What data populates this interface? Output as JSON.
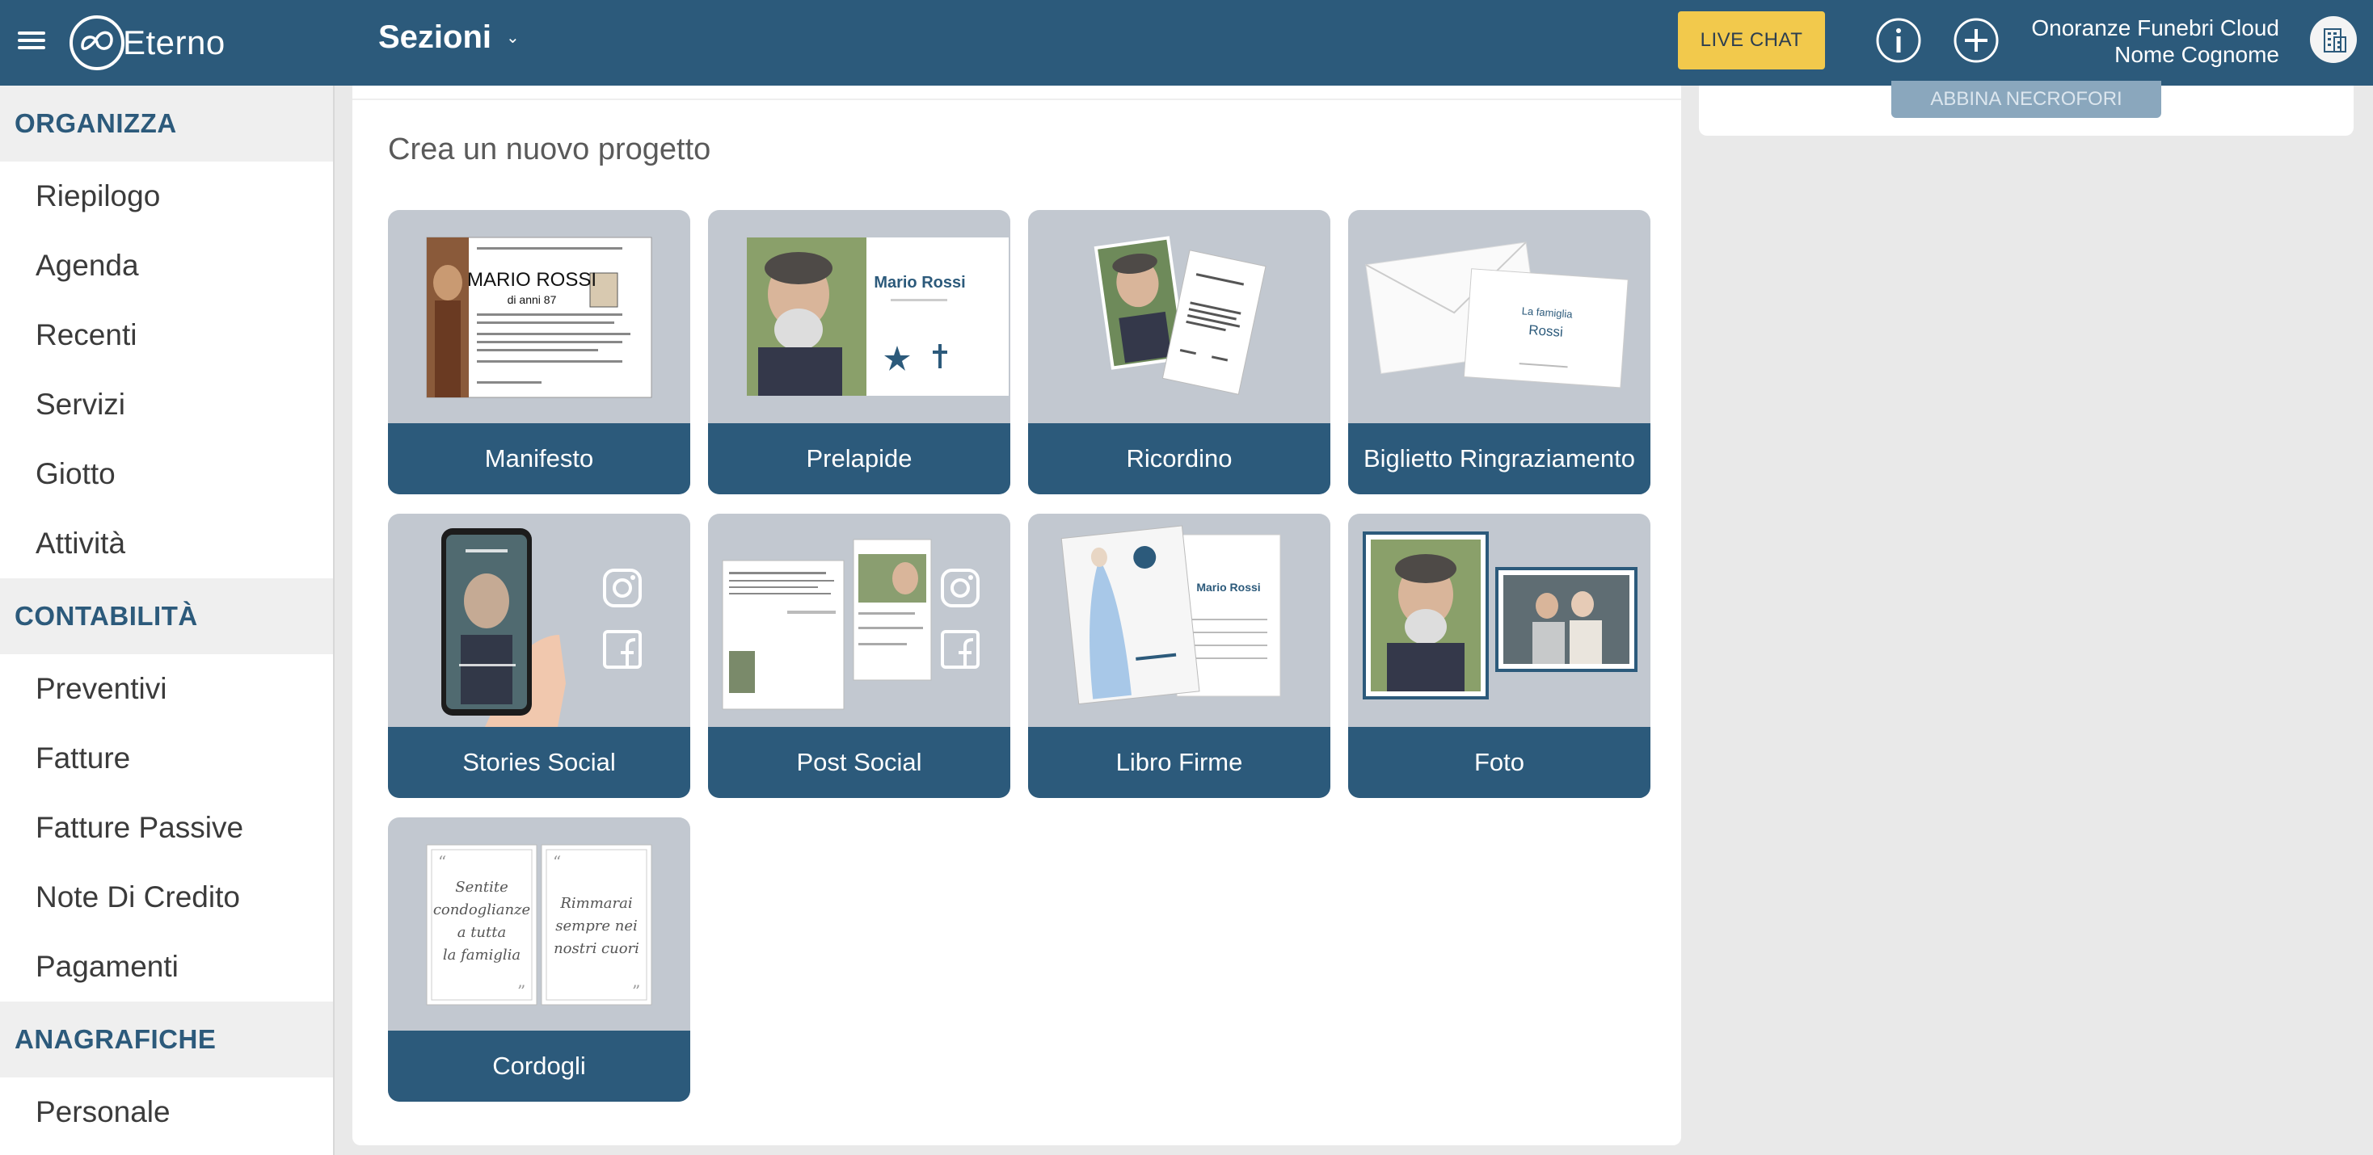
{
  "topbar": {
    "brand": "Eterno",
    "section_menu": "Sezioni",
    "live_chat": "LIVE CHAT",
    "account_company": "Onoranze Funebri Cloud",
    "account_user": "Nome Cognome",
    "icons": [
      "menu-icon",
      "info-icon",
      "plus-circle-icon",
      "building-avatar-icon"
    ]
  },
  "sidebar": {
    "organizza": "ORGANIZZA",
    "riepilogo": "Riepilogo",
    "agenda": "Agenda",
    "recenti": "Recenti",
    "servizi": "Servizi",
    "giotto": "Giotto",
    "attivita": "Attività",
    "contabilita": "CONTABILITÀ",
    "preventivi": "Preventivi",
    "fatture": "Fatture",
    "fatture_passive": "Fatture Passive",
    "note_credito": "Note Di Credito",
    "pagamenti": "Pagamenti",
    "anagrafiche": "ANAGRAFICHE",
    "personale": "Personale"
  },
  "main": {
    "title": "Crea un nuovo progetto",
    "tiles": {
      "manifesto": "Manifesto",
      "prelapide": "Prelapide",
      "ricordino": "Ricordino",
      "biglietto": "Biglietto Ringraziamento",
      "stories": "Stories Social",
      "post": "Post Social",
      "libro": "Libro Firme",
      "foto": "Foto",
      "cordogli": "Cordogli"
    },
    "thumbs": {
      "manifesto_name": "MARIO ROSSI",
      "manifesto_age": "di anni 87",
      "prelapide_name": "Mario Rossi",
      "biglietto_family": "La famiglia",
      "biglietto_name": "Rossi",
      "libro_name": "Mario Rossi",
      "cordogli_left": [
        "Sentite",
        "condoglianze",
        "a tutta",
        "la famiglia"
      ],
      "cordogli_right": [
        "Rimmarai",
        "sempre nei",
        "nostri cuori"
      ]
    }
  },
  "right_panel": {
    "abbina_button": "ABBINA NECROFORI"
  },
  "colors": {
    "primary": "#2c5a7b",
    "accent": "#f2c94c",
    "tile_bg": "#c2c8d0",
    "page_bg": "#e9e9e9"
  }
}
